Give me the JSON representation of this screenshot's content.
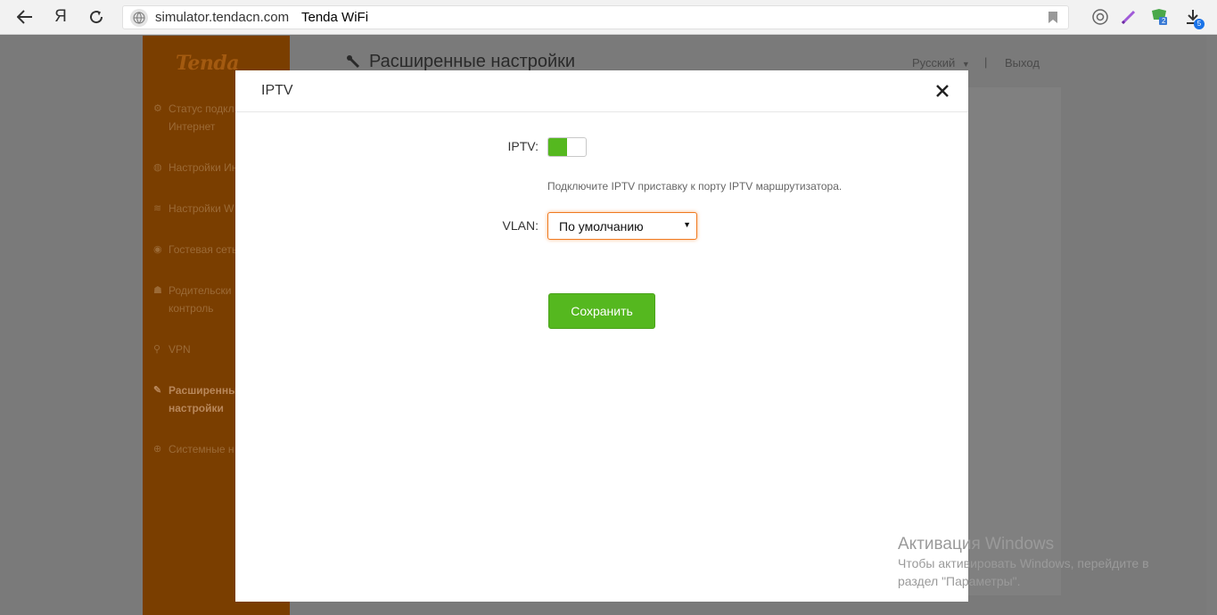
{
  "browser": {
    "url": "simulator.tendacn.com",
    "page_title": "Tenda WiFi",
    "yandex_label": "Я",
    "downloads_badge": "5",
    "ext_badge": "2"
  },
  "sidebar": {
    "logo": "Tenda",
    "items": [
      {
        "line1": "Статус подкл",
        "line2": "Интернет"
      },
      {
        "line1": "Настройки Ин",
        "line2": ""
      },
      {
        "line1": "Настройки W",
        "line2": ""
      },
      {
        "line1": "Гостевая сеть",
        "line2": ""
      },
      {
        "line1": "Родительски",
        "line2": "контроль"
      },
      {
        "line1": "VPN",
        "line2": ""
      },
      {
        "line1": "Расширенны",
        "line2": "настройки"
      },
      {
        "line1": "Системные н",
        "line2": ""
      }
    ]
  },
  "header": {
    "title": "Расширенные настройки",
    "language": "Русский",
    "separator": "|",
    "logout": "Выход"
  },
  "modal": {
    "title": "IPTV",
    "iptv_label": "IPTV:",
    "iptv_enabled": true,
    "hint": "Подключите IPTV приставку к порту IPTV маршрутизатора.",
    "vlan_label": "VLAN:",
    "vlan_value": "По умолчанию",
    "save_label": "Сохранить"
  },
  "watermark": {
    "title": "Активация Windows",
    "line1": "Чтобы активировать Windows, перейдите в",
    "line2": "раздел \"Параметры\"."
  },
  "colors": {
    "accent_green": "#55b81f",
    "sidebar_brown": "#7a3e00",
    "focus_orange": "#f07a1f"
  }
}
